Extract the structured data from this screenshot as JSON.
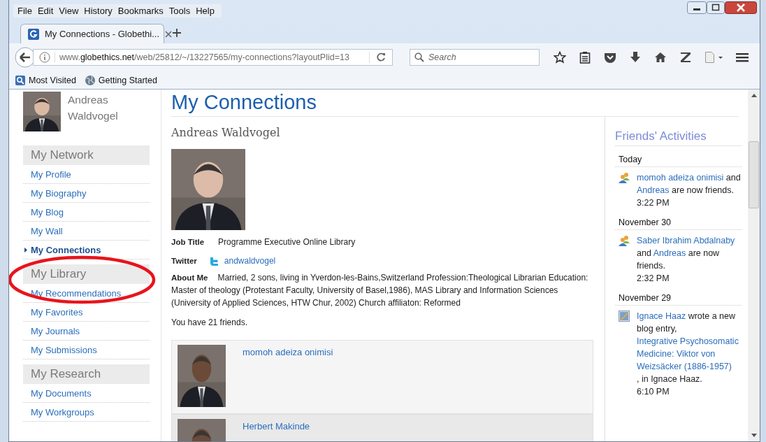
{
  "menu": [
    "File",
    "Edit",
    "View",
    "History",
    "Bookmarks",
    "Tools",
    "Help"
  ],
  "tabs": [
    {
      "title": "My Connections - Globethi...",
      "selected": true
    }
  ],
  "address_bar": {
    "url": "www.**globethics.net**/web/25812/~/13227565/my-connections?layoutPlid=13"
  },
  "search": {
    "placeholder": "Search"
  },
  "bookmarks": [
    {
      "label": "Most Visited",
      "kind": "folder"
    },
    {
      "label": "Getting Started",
      "kind": "globe"
    }
  ],
  "sidebar": {
    "user_name": "Andreas Waldvogel",
    "sections": [
      {
        "title": "My Network",
        "items": [
          {
            "label": "My Profile",
            "selected": false
          },
          {
            "label": "My Biography",
            "selected": false
          },
          {
            "label": "My Blog",
            "selected": false
          },
          {
            "label": "My Wall",
            "selected": false
          },
          {
            "label": "My Connections",
            "selected": true
          }
        ]
      },
      {
        "title": "My Library",
        "items": [
          {
            "label": "My Recommendations",
            "selected": false
          },
          {
            "label": "My Favorites",
            "selected": false
          },
          {
            "label": "My Journals",
            "selected": false
          },
          {
            "label": "My Submissions",
            "selected": false
          }
        ]
      },
      {
        "title": "My Research",
        "items": [
          {
            "label": "My Documents",
            "selected": false
          },
          {
            "label": "My Workgroups",
            "selected": false
          }
        ]
      }
    ]
  },
  "annotations": [
    {
      "kind": "ellipse"
    }
  ],
  "main": {
    "title": "My Connections",
    "profile_name": "Andreas Waldvogel",
    "fields": [
      {
        "label": "Job Title",
        "value": "Programme Executive Online Library",
        "kind": "text"
      },
      {
        "label": "Twitter",
        "value": "andwaldvogel",
        "kind": "twitter"
      },
      {
        "label": "About Me",
        "kind": "paragraph",
        "value": "Married, 2 sons, living in Yverdon-les-Bains,Switzerland Profession:Theological Librarian Education: Master of theology (Protestant Faculty, University of Basel,1986), MAS Library and Information Sciences (University of Applied Sciences, HTW Chur, 2002) Church affiliaton: Reformed"
      }
    ],
    "friends_count": "You have 21 friends.",
    "friends": [
      {
        "name": "momoh adeiza onimisi"
      },
      {
        "name": "Herbert Makinde"
      }
    ]
  },
  "activities": {
    "title": "Friends' Activities",
    "groups": [
      {
        "date": "Today",
        "entries": [
          {
            "kind": "friendship",
            "time": "3:22 PM",
            "parts": [
              {
                "text": "momoh adeiza onimisi",
                "link": true
              },
              {
                "text": " and ",
                "link": false
              },
              {
                "text": "Andreas",
                "link": true
              },
              {
                "text": " are now friends.",
                "link": false
              }
            ]
          }
        ]
      },
      {
        "date": "November 30",
        "entries": [
          {
            "kind": "friendship",
            "time": "2:32 PM",
            "parts": [
              {
                "text": "Saber Ibrahim Abdalnaby",
                "link": true
              },
              {
                "text": " and ",
                "link": false
              },
              {
                "text": "Andreas",
                "link": true
              },
              {
                "text": " are now friends.",
                "link": false
              }
            ]
          }
        ]
      },
      {
        "date": "November 29",
        "entries": [
          {
            "kind": "blog",
            "time": "6:10 PM",
            "parts": [
              {
                "text": "Ignace Haaz",
                "link": true
              },
              {
                "text": " wrote a new blog entry, ",
                "link": false
              },
              {
                "text": "Integrative Psychosomatic Medicine: Viktor von Weizsäcker (1886-1957)",
                "link": true
              },
              {
                "text": ", in Ignace Haaz.",
                "link": false
              }
            ]
          }
        ]
      }
    ]
  }
}
